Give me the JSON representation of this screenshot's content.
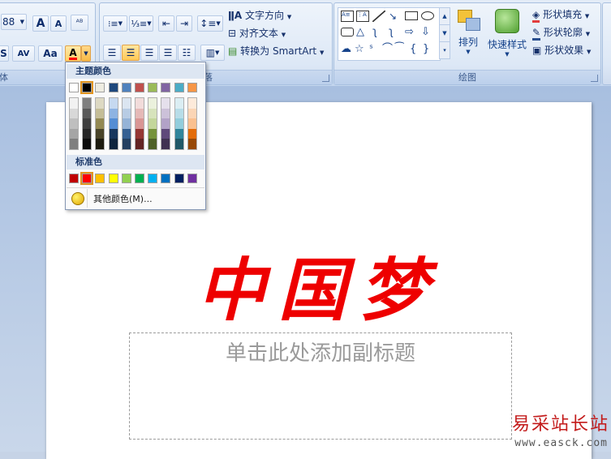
{
  "ribbon": {
    "font_size_value": "88",
    "groups": {
      "font_label": "体",
      "paragraph_label": "落",
      "drawing_label": "绘图"
    },
    "paragraph": {
      "text_direction": "文字方向",
      "align_text": "对齐文本",
      "convert_smartart": "转换为 SmartArt"
    },
    "drawing": {
      "arrange": "排列",
      "quick_styles": "快速样式",
      "shape_fill": "形状填充",
      "shape_outline": "形状轮廓",
      "shape_effects": "形状效果"
    },
    "font_buttons": {
      "grow": "A",
      "shrink": "A",
      "spacing": "AV",
      "case": "Aa",
      "color": "A",
      "shadow": "S"
    }
  },
  "color_menu": {
    "theme_header": "主题颜色",
    "standard_header": "标准色",
    "more_colors": "其他颜色(M)...",
    "theme_colors": [
      "#ffffff",
      "#000000",
      "#eeece1",
      "#1f497d",
      "#4f81bd",
      "#c0504d",
      "#9bbb59",
      "#8064a2",
      "#4bacc6",
      "#f79646"
    ],
    "theme_tints": [
      [
        "#f2f2f2",
        "#d8d8d8",
        "#bfbfbf",
        "#a5a5a5",
        "#7f7f7f"
      ],
      [
        "#7f7f7f",
        "#595959",
        "#3f3f3f",
        "#262626",
        "#0c0c0c"
      ],
      [
        "#ddd9c3",
        "#c4bd97",
        "#938953",
        "#494429",
        "#1d1b10"
      ],
      [
        "#c6d9f0",
        "#8db3e2",
        "#548dd4",
        "#17365d",
        "#0f243e"
      ],
      [
        "#dbe5f1",
        "#b8cce4",
        "#95b3d7",
        "#366092",
        "#244061"
      ],
      [
        "#f2dcdb",
        "#e5b9b7",
        "#d99694",
        "#953734",
        "#632423"
      ],
      [
        "#ebf1dd",
        "#d7e3bc",
        "#c3d69b",
        "#76923c",
        "#4f6128"
      ],
      [
        "#e5e0ec",
        "#ccc1d9",
        "#b2a2c7",
        "#5f497a",
        "#3f3151"
      ],
      [
        "#dbeef3",
        "#b7dde8",
        "#92cddc",
        "#31859b",
        "#205867"
      ],
      [
        "#fdeada",
        "#fbd5b5",
        "#fac08f",
        "#e36c09",
        "#974806"
      ]
    ],
    "standard_colors": [
      "#c00000",
      "#ff0000",
      "#ffc000",
      "#ffff00",
      "#92d050",
      "#00b050",
      "#00b0f0",
      "#0070c0",
      "#002060",
      "#7030a0"
    ]
  },
  "slide": {
    "title": "中国梦",
    "subtitle_placeholder": "单击此处添加副标题"
  },
  "watermark": {
    "cn": "易采站长站",
    "url": "www.easck.com"
  }
}
